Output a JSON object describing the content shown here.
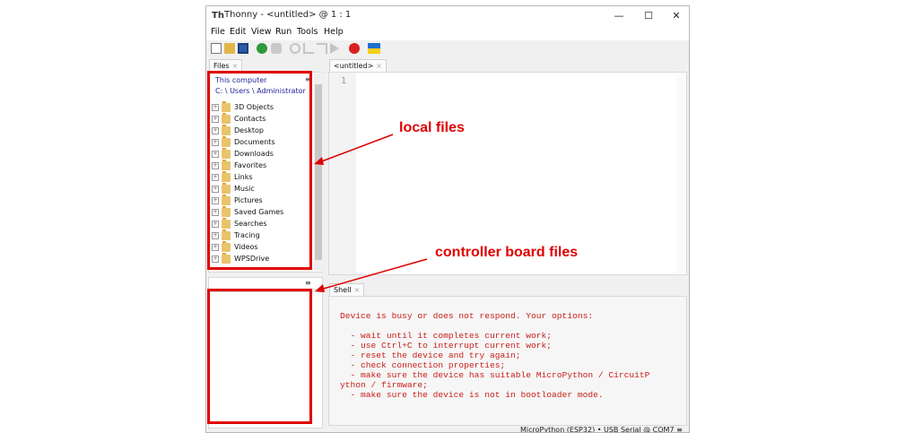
{
  "window": {
    "title": "Thonny  -  <untitled>  @  1 : 1",
    "controls": [
      "—",
      "☐",
      "✕"
    ]
  },
  "menu": [
    "File",
    "Edit",
    "View",
    "Run",
    "Tools",
    "Help"
  ],
  "toolbar": {
    "icons": [
      "new-file-icon",
      "open-file-icon",
      "save-icon",
      "run-icon",
      "debug-icon",
      "step-over-icon",
      "step-into-icon",
      "step-out-icon",
      "resume-icon",
      "stop-icon",
      "support-ukraine-icon"
    ],
    "colors": {
      "run": "#2e9a3a",
      "stop": "#d92020",
      "flag_blue": "#1f6fd0",
      "flag_yellow": "#f6cf1c"
    }
  },
  "files_tab": {
    "label": "Files",
    "close": "×"
  },
  "editor_tab": {
    "label": "<untitled>",
    "close": "×"
  },
  "files": {
    "location_title": "This computer",
    "path": "C: \\ Users \\ Administrator",
    "menu_glyph": "≡",
    "expander": "+",
    "items": [
      "3D Objects",
      "Contacts",
      "Desktop",
      "Documents",
      "Downloads",
      "Favorites",
      "Links",
      "Music",
      "Pictures",
      "Saved Games",
      "Searches",
      "Tracing",
      "Videos",
      "WPSDrive"
    ]
  },
  "board": {
    "menu_glyph": "≡"
  },
  "editor": {
    "line_number": "1"
  },
  "shell": {
    "tab_label": "Shell",
    "close": "×",
    "lines": [
      "Device is busy or does not respond. Your options:",
      "",
      "  - wait until it completes current work;",
      "  - use Ctrl+C to interrupt current work;",
      "  - reset the device and try again;",
      "  - check connection properties;",
      "  - make sure the device has suitable MicroPython / CircuitP",
      "ython / firmware;",
      "  - make sure the device is not in bootloader mode."
    ]
  },
  "status_bar": {
    "interpreter": "MicroPython (ESP32)  •  USB Serial @ COM7  ≡"
  },
  "annotations": {
    "local_files": "local files",
    "board_files": "controller board files",
    "color": "#e00000"
  }
}
